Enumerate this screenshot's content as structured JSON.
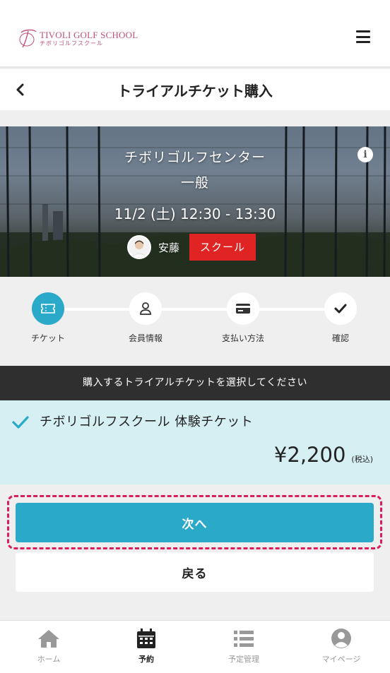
{
  "header": {
    "logo_en": "TIVOLI GOLF SCHOOL",
    "logo_jp": "チボリゴルフスクール"
  },
  "title_bar": {
    "title": "トライアルチケット購入"
  },
  "hero": {
    "venue": "チボリゴルフセンター",
    "category": "一般",
    "datetime": "11/2 (土) 12:30 - 13:30",
    "instructor": "安藤",
    "badge": "スクール"
  },
  "steps": [
    {
      "label": "チケット",
      "icon": "ticket-icon",
      "active": true
    },
    {
      "label": "会員情報",
      "icon": "person-icon",
      "active": false
    },
    {
      "label": "支払い方法",
      "icon": "credit-card-icon",
      "active": false
    },
    {
      "label": "確認",
      "icon": "checkmark-icon",
      "active": false
    }
  ],
  "section": {
    "instruction": "購入するトライアルチケットを選択してください"
  },
  "ticket": {
    "name": "チボリゴルフスクール 体験チケット",
    "price": "¥2,200",
    "tax": "(税込)",
    "selected": true
  },
  "buttons": {
    "next": "次へ",
    "back": "戻る"
  },
  "bottom_nav": [
    {
      "label": "ホーム",
      "icon": "home-icon",
      "active": false
    },
    {
      "label": "予約",
      "icon": "calendar-icon",
      "active": true
    },
    {
      "label": "予定管理",
      "icon": "list-icon",
      "active": false
    },
    {
      "label": "マイページ",
      "icon": "user-circle-icon",
      "active": false
    }
  ],
  "colors": {
    "accent": "#2aa9c9",
    "badge": "#e02424",
    "highlight": "#d81e5b",
    "brand": "#c0507c",
    "ticket_bg": "#d5eff3"
  }
}
